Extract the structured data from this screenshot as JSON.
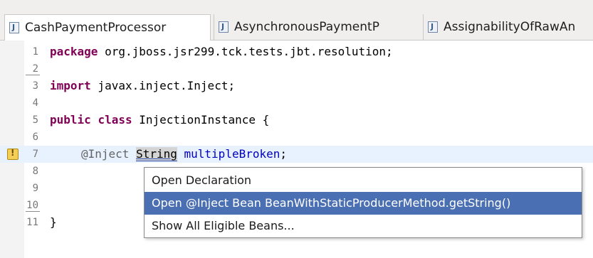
{
  "tabs": [
    {
      "label": "CashPaymentProcessor",
      "icon": "java-file-icon",
      "active": true
    },
    {
      "label": "AsynchronousPaymentP",
      "icon": "java-file-icon",
      "active": false
    },
    {
      "label": "AssignabilityOfRawAn",
      "icon": "java-file-icon",
      "active": false
    }
  ],
  "lines": [
    {
      "num": "1",
      "text": "package org.jboss.jsr299.tck.tests.jbt.resolution;"
    },
    {
      "num": "2",
      "text": ""
    },
    {
      "num": "3",
      "text": "import javax.inject.Inject;"
    },
    {
      "num": "4",
      "text": ""
    },
    {
      "num": "5",
      "text": "public class InjectionInstance {"
    },
    {
      "num": "6",
      "text": ""
    },
    {
      "num": "7",
      "text": "@Inject String multipleBroken;"
    },
    {
      "num": "8",
      "text": ""
    },
    {
      "num": "9",
      "text": ""
    },
    {
      "num": "10",
      "text": ""
    },
    {
      "num": "11",
      "text": "}"
    }
  ],
  "code": {
    "kw_package": "package",
    "pkg_name": " org.jboss.jsr299.tck.tests.jbt.resolution;",
    "kw_import": "import",
    "import_name": " javax.inject.Inject;",
    "kw_public": "public",
    "kw_class": "class",
    "class_name": " InjectionInstance {",
    "annotation": "@Inject",
    "type_name": "String",
    "field_name": "multipleBroken",
    "semicolon": ";",
    "close_brace": "}"
  },
  "popup": {
    "items": [
      {
        "label": "Open Declaration",
        "selected": false
      },
      {
        "label": "Open @Inject Bean BeanWithStaticProducerMethod.getString()",
        "selected": true
      },
      {
        "label": "Show All Eligible Beans...",
        "selected": false
      }
    ]
  },
  "colors": {
    "keyword": "#7f0055",
    "field": "#0000c0",
    "selection": "#4a6fb2"
  }
}
